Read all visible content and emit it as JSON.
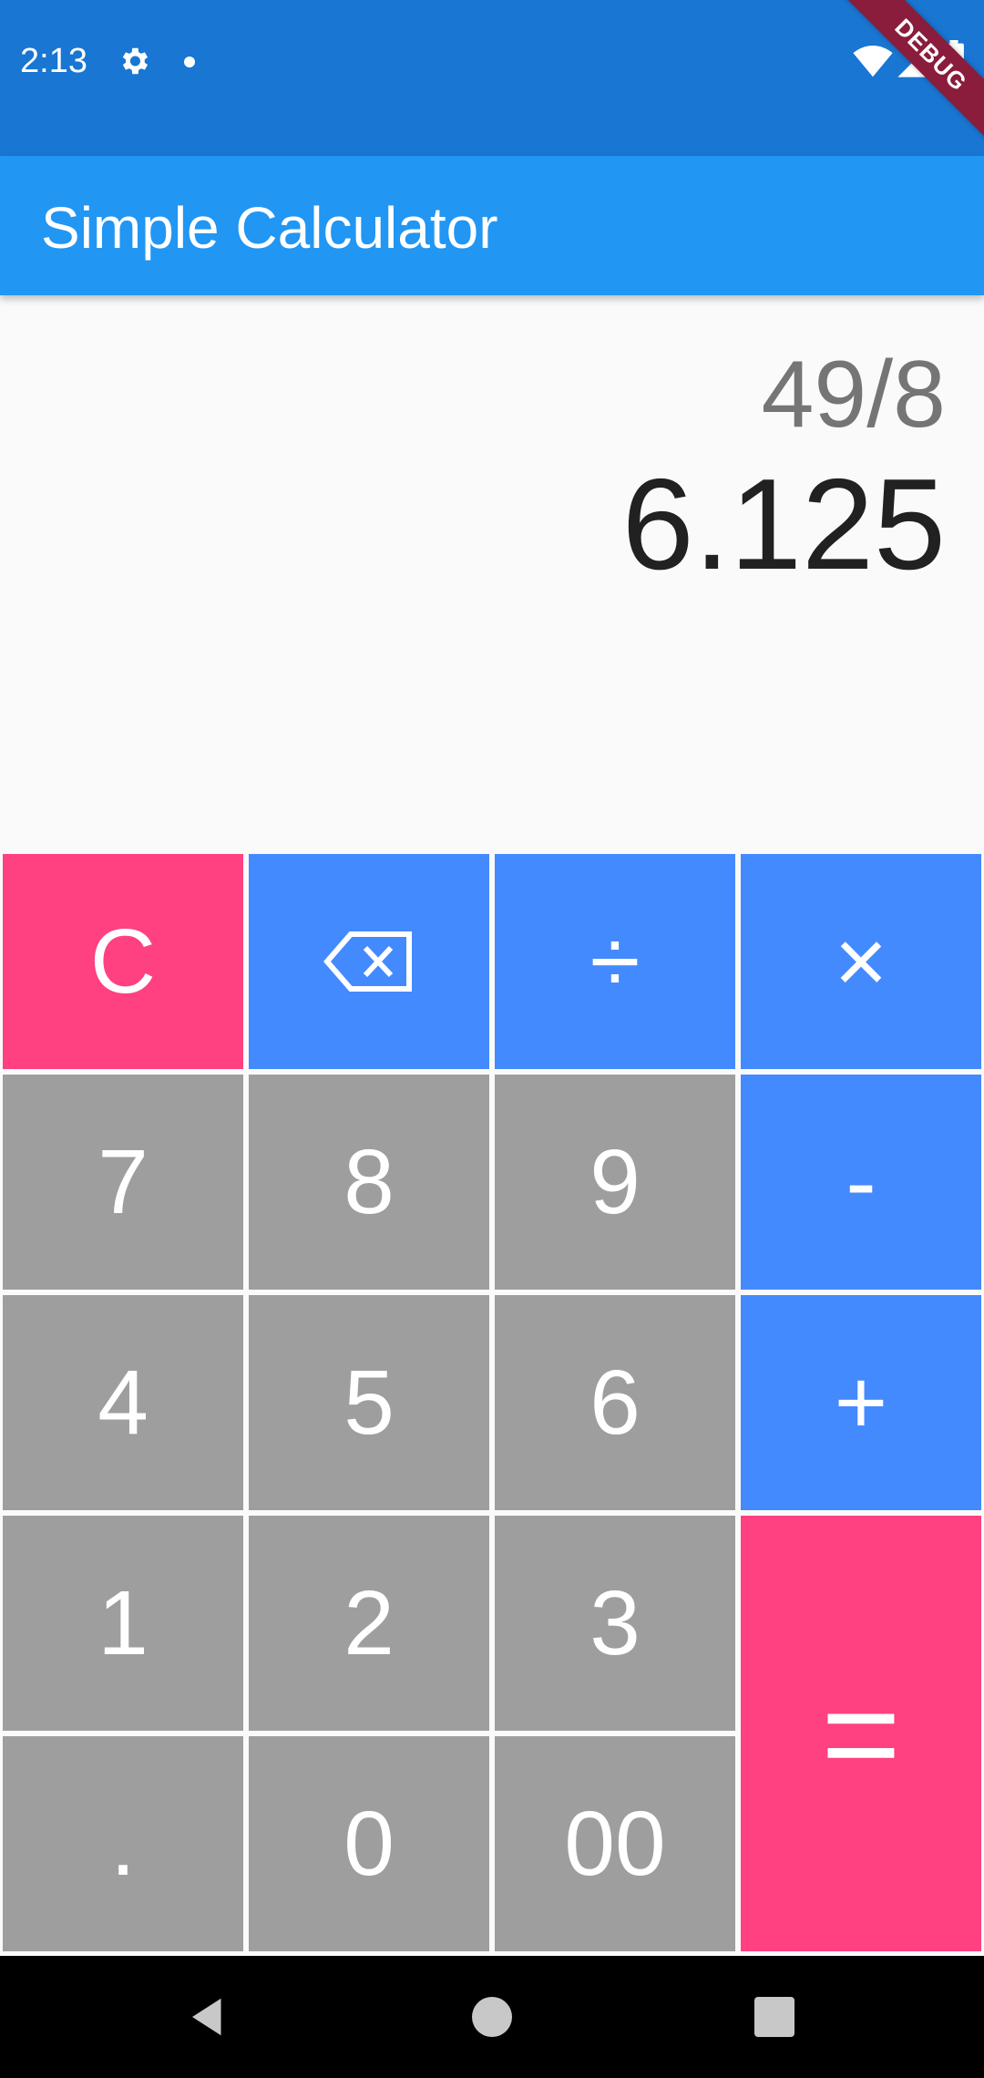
{
  "status_bar": {
    "time": "2:13",
    "debug_label": "DEBUG",
    "icons": [
      "gear-icon",
      "notification-dot-icon",
      "wifi-icon",
      "signal-icon",
      "battery-icon"
    ]
  },
  "app_bar": {
    "title": "Simple Calculator"
  },
  "display": {
    "expression": "49/8",
    "result": "6.125"
  },
  "keypad": {
    "clear": "C",
    "backspace_icon": "backspace-icon",
    "divide": "÷",
    "multiply": "×",
    "seven": "7",
    "eight": "8",
    "nine": "9",
    "minus": "-",
    "four": "4",
    "five": "5",
    "six": "6",
    "plus": "+",
    "one": "1",
    "two": "2",
    "three": "3",
    "equals": "=",
    "dot": ".",
    "zero": "0",
    "double_zero": "00"
  },
  "colors": {
    "status_bar": "#1976d2",
    "app_bar": "#2196f3",
    "number_key": "#9e9e9e",
    "operator_key": "#448aff",
    "accent_key": "#ff4081"
  },
  "nav_bar": {
    "icons": [
      "back-icon",
      "home-icon",
      "recents-icon"
    ]
  }
}
